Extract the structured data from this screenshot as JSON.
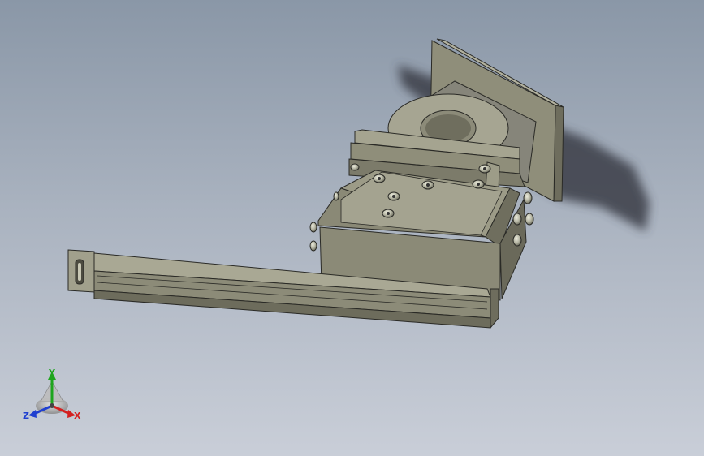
{
  "colors": {
    "body": "#8f8e7a",
    "body_light": "#a3a28e",
    "body_dark": "#6d6c5c",
    "edge": "#2a2a26",
    "shadow": "#3b3f48",
    "bolt": "#c9c9b8",
    "axis_x": "#d42020",
    "axis_y": "#1ea51e",
    "axis_z": "#2040d0"
  },
  "triad": {
    "x_label": "X",
    "y_label": "Y",
    "z_label": "Z"
  }
}
